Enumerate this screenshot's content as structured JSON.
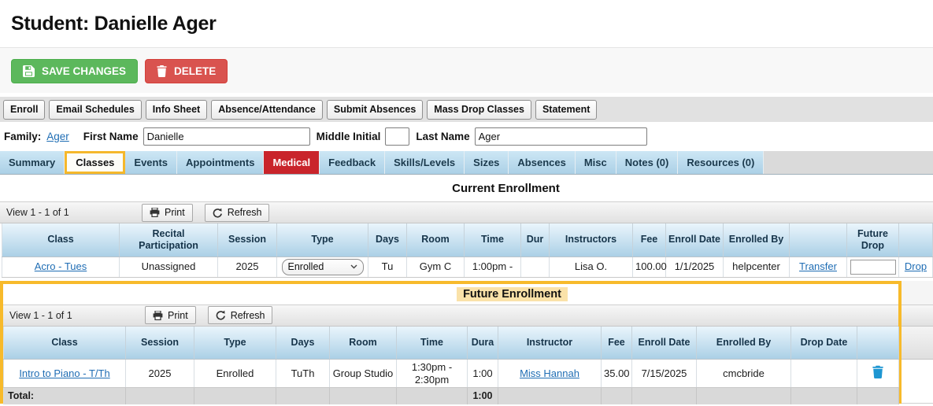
{
  "page": {
    "title": "Student: Danielle Ager"
  },
  "primary_actions": {
    "save_label": "SAVE CHANGES",
    "delete_label": "DELETE"
  },
  "action_buttons": [
    "Enroll",
    "Email Schedules",
    "Info Sheet",
    "Absence/Attendance",
    "Submit Absences",
    "Mass Drop Classes",
    "Statement"
  ],
  "form": {
    "family_label": "Family:",
    "family_link": "Ager",
    "first_name_label": "First Name",
    "first_name_value": "Danielle",
    "middle_initial_label": "Middle Initial",
    "middle_initial_value": "",
    "last_name_label": "Last Name",
    "last_name_value": "Ager"
  },
  "tabs": [
    {
      "label": "Summary",
      "state": "normal"
    },
    {
      "label": "Classes",
      "state": "highlighted"
    },
    {
      "label": "Events",
      "state": "normal"
    },
    {
      "label": "Appointments",
      "state": "normal"
    },
    {
      "label": "Medical",
      "state": "alert"
    },
    {
      "label": "Feedback",
      "state": "normal"
    },
    {
      "label": "Skills/Levels",
      "state": "normal"
    },
    {
      "label": "Sizes",
      "state": "normal"
    },
    {
      "label": "Absences",
      "state": "normal"
    },
    {
      "label": "Misc",
      "state": "normal"
    },
    {
      "label": "Notes (0)",
      "state": "normal"
    },
    {
      "label": "Resources (0)",
      "state": "normal"
    }
  ],
  "current_enrollment": {
    "title": "Current Enrollment",
    "view_text": "View 1 - 1 of 1",
    "print_label": "Print",
    "refresh_label": "Refresh",
    "columns": [
      "Class",
      "Recital Participation",
      "Session",
      "Type",
      "Days",
      "Room",
      "Time",
      "Dur",
      "Instructors",
      "Fee",
      "Enroll Date",
      "Enrolled By",
      "",
      "Future Drop",
      ""
    ],
    "row": {
      "class_link": "Acro - Tues",
      "recital_participation": "Unassigned",
      "session": "2025",
      "type": "Enrolled",
      "days": "Tu",
      "room": "Gym C",
      "time": "1:00pm -",
      "dur": "",
      "instructors": "Lisa O.",
      "fee": "100.00",
      "enroll_date": "1/1/2025",
      "enrolled_by": "helpcenter",
      "transfer_link": "Transfer",
      "future_drop_value": "",
      "drop_link": "Drop"
    }
  },
  "future_enrollment": {
    "title": "Future Enrollment",
    "view_text": "View 1 - 1 of 1",
    "print_label": "Print",
    "refresh_label": "Refresh",
    "columns": [
      "Class",
      "Session",
      "Type",
      "Days",
      "Room",
      "Time",
      "Dura",
      "Instructor",
      "Fee",
      "Enroll Date",
      "Enrolled By",
      "Drop Date",
      ""
    ],
    "row": {
      "class_link": "Intro to Piano - T/Th",
      "session": "2025",
      "type": "Enrolled",
      "days": "TuTh",
      "room": "Group Studio",
      "time": "1:30pm - 2:30pm",
      "dura": "1:00",
      "instructor_link": "Miss Hannah",
      "fee": "35.00",
      "enroll_date": "7/15/2025",
      "enrolled_by": "cmcbride",
      "drop_date": ""
    },
    "total_label": "Total:",
    "total_dura": "1:00"
  },
  "icons": {
    "save": "floppy-disk",
    "delete": "trash",
    "print": "printer",
    "refresh": "circular-arrow",
    "type_select": "chevron-down",
    "future_row_delete": "trash"
  },
  "colors": {
    "save_green": "#5cb85c",
    "delete_red": "#d9534f",
    "tab_blue": "#b9d8ea",
    "medical_tab_red": "#c9242b",
    "highlight_orange": "#f7ba2b",
    "future_title_highlight": "#fae2a9",
    "link_blue": "#1f6db4",
    "trash_icon_blue": "#1e96d2"
  }
}
